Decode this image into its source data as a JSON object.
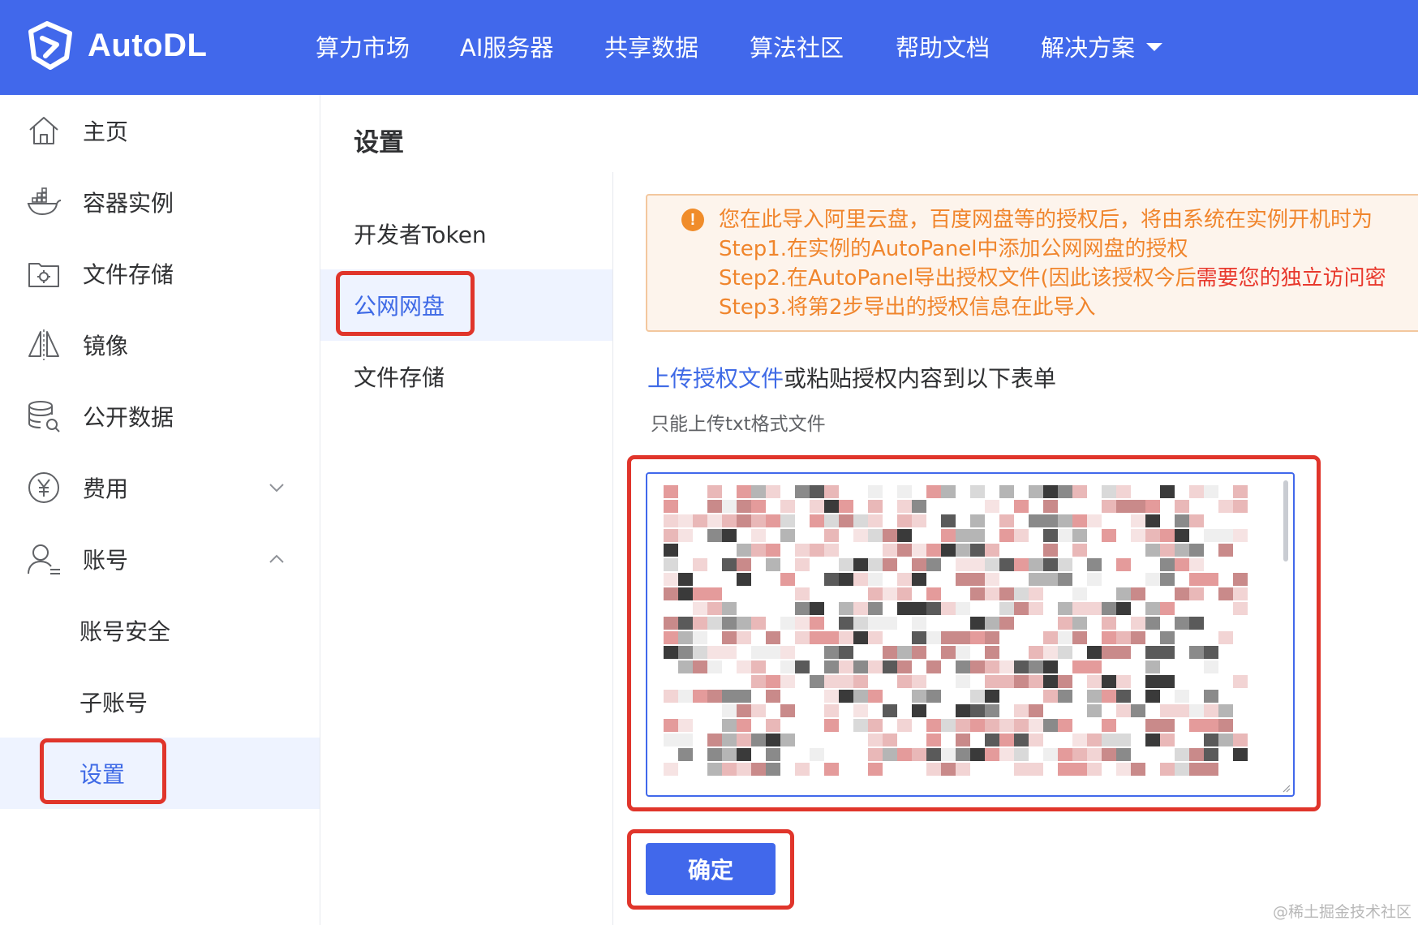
{
  "header": {
    "logo_text": "AutoDL",
    "nav": [
      {
        "label": "算力市场"
      },
      {
        "label": "AI服务器"
      },
      {
        "label": "共享数据"
      },
      {
        "label": "算法社区"
      },
      {
        "label": "帮助文档"
      },
      {
        "label": "解决方案",
        "has_dropdown": true
      }
    ]
  },
  "sidebar": {
    "items": [
      {
        "label": "主页",
        "icon": "home-icon"
      },
      {
        "label": "容器实例",
        "icon": "docker-icon"
      },
      {
        "label": "文件存储",
        "icon": "storage-icon"
      },
      {
        "label": "镜像",
        "icon": "mirror-icon"
      },
      {
        "label": "公开数据",
        "icon": "database-icon"
      },
      {
        "label": "费用",
        "icon": "yen-icon",
        "expanded": false
      },
      {
        "label": "账号",
        "icon": "user-icon",
        "expanded": true
      }
    ],
    "sub_items": [
      {
        "label": "账号安全"
      },
      {
        "label": "子账号"
      },
      {
        "label": "设置",
        "active": true
      }
    ]
  },
  "settings": {
    "title": "设置",
    "menu": [
      {
        "label": "开发者Token"
      },
      {
        "label": "公网网盘",
        "active": true
      },
      {
        "label": "文件存储"
      }
    ]
  },
  "alert": {
    "line1": "您在此导入阿里云盘，百度网盘等的授权后，将由系统在实例开机时为",
    "line2": "Step1.在实例的AutoPanel中添加公网网盘的授权",
    "line3_a": "Step2.在AutoPanel导出授权文件(因此该授权今后",
    "line3_b": "需要您的独立访问密",
    "line4": "Step3.将第2步导出的授权信息在此导入"
  },
  "upload": {
    "link_label": "上传授权文件",
    "rest_label": "或粘贴授权内容到以下表单",
    "hint": "只能上传txt格式文件"
  },
  "confirm_label": "确定",
  "watermark": "@稀土掘金技术社区",
  "colors": {
    "brand": "#4168eb",
    "active_text": "#3f6ae6",
    "warning": "#f0852c",
    "highlight_box": "#e0352b"
  }
}
